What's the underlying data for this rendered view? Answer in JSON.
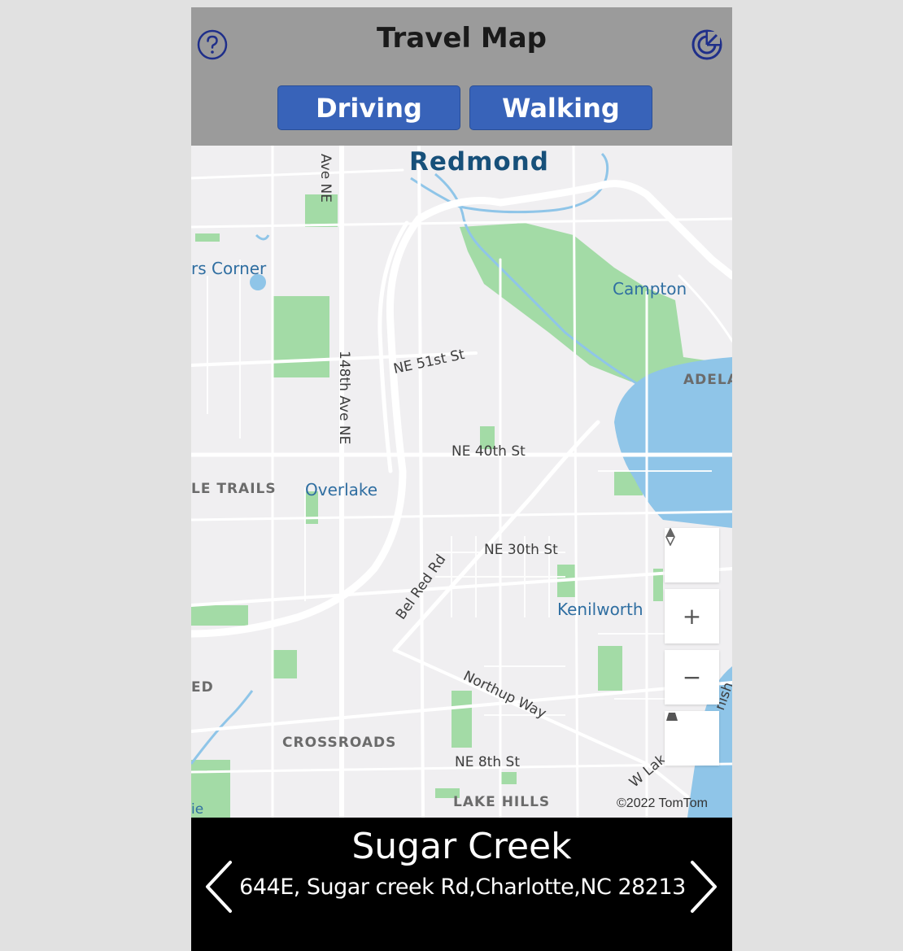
{
  "header": {
    "title": "Travel Map",
    "help_icon": "help-circle-icon",
    "radar_icon": "radar-icon",
    "buttons": {
      "driving": "Driving",
      "walking": "Walking"
    }
  },
  "map": {
    "labels": {
      "redmond": "Redmond",
      "ave_ne_top": "Ave NE",
      "rs_corner": "rs Corner",
      "campton": "Campton",
      "ne_51st": "NE 51st St",
      "ave_148th": "148th Ave NE",
      "adela": "ADELA",
      "ne_40th": "NE 40th St",
      "le_trails": "LE TRAILS",
      "overlake": "Overlake",
      "ne_30th": "NE 30th St",
      "bel_red": "Bel Red Rd",
      "kenilworth": "Kenilworth",
      "northup": "Northup Way",
      "ed": "ED",
      "crossroads": "CROSSROADS",
      "ne_8th": "NE 8th St",
      "lake_hills": "LAKE HILLS",
      "w_lak": "W Lak",
      "nish": "nish",
      "ge": "ie"
    },
    "controls": {
      "compass_icon": "compass-icon",
      "zoom_in": "+",
      "zoom_out": "−",
      "tilt_icon": "tilt-icon"
    },
    "copyright": "©2022 TomTom",
    "colors": {
      "land": "#f0eff1",
      "park": "#a3dba6",
      "water": "#8fc5e8",
      "road": "#ffffff"
    }
  },
  "footer": {
    "location_name": "Sugar Creek",
    "address": "644E, Sugar creek Rd,Charlotte,NC 28213",
    "prev_icon": "chevron-left-icon",
    "next_icon": "chevron-right-icon"
  }
}
